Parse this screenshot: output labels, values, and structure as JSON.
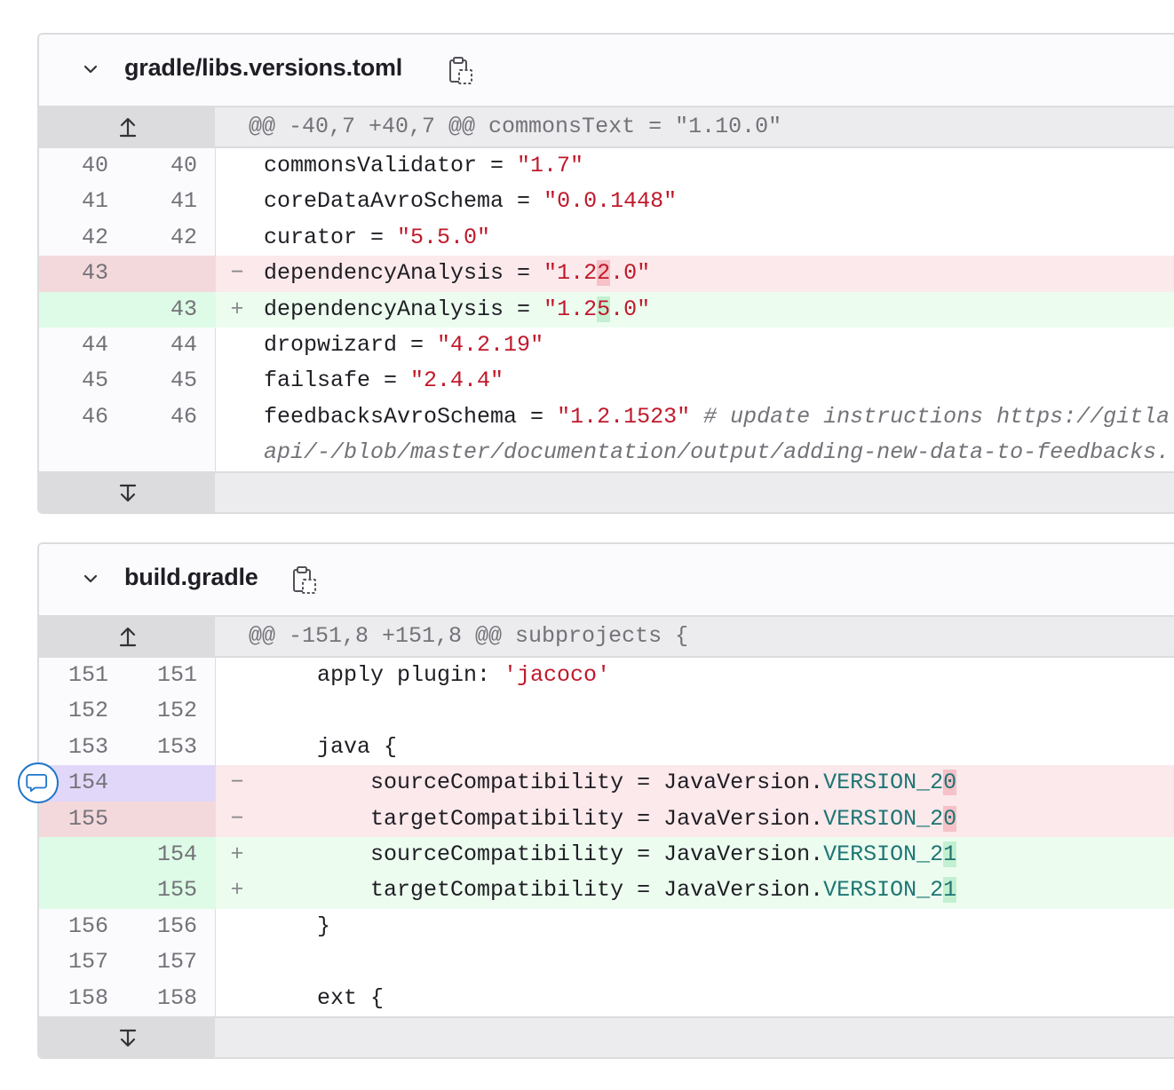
{
  "files": [
    {
      "name": "gradle/libs.versions.toml",
      "hunk_header": "@@ -40,7 +40,7 @@ commonsText = \"1.10.0\"",
      "lines": [
        {
          "type": "ctx",
          "old": "40",
          "new": "40",
          "marker": "",
          "segments": [
            {
              "t": "commonsValidator = "
            },
            {
              "t": "\"1.7\"",
              "c": "s2"
            }
          ]
        },
        {
          "type": "ctx",
          "old": "41",
          "new": "41",
          "marker": "",
          "segments": [
            {
              "t": "coreDataAvroSchema = "
            },
            {
              "t": "\"0.0.1448\"",
              "c": "s2"
            }
          ]
        },
        {
          "type": "ctx",
          "old": "42",
          "new": "42",
          "marker": "",
          "segments": [
            {
              "t": "curator = "
            },
            {
              "t": "\"5.5.0\"",
              "c": "s2"
            }
          ]
        },
        {
          "type": "del",
          "old": "43",
          "new": "",
          "marker": "−",
          "segments": [
            {
              "t": "dependencyAnalysis = "
            },
            {
              "t": "\"1.2",
              "c": "s2"
            },
            {
              "t": "2",
              "c": "s2 hl-del"
            },
            {
              "t": ".0\"",
              "c": "s2"
            }
          ]
        },
        {
          "type": "add",
          "old": "",
          "new": "43",
          "marker": "+",
          "segments": [
            {
              "t": "dependencyAnalysis = "
            },
            {
              "t": "\"1.2",
              "c": "s2"
            },
            {
              "t": "5",
              "c": "s2 hl-add"
            },
            {
              "t": ".0\"",
              "c": "s2"
            }
          ]
        },
        {
          "type": "ctx",
          "old": "44",
          "new": "44",
          "marker": "",
          "segments": [
            {
              "t": "dropwizard = "
            },
            {
              "t": "\"4.2.19\"",
              "c": "s2"
            }
          ]
        },
        {
          "type": "ctx",
          "old": "45",
          "new": "45",
          "marker": "",
          "segments": [
            {
              "t": "failsafe = "
            },
            {
              "t": "\"2.4.4\"",
              "c": "s2"
            }
          ]
        },
        {
          "type": "ctx",
          "old": "46",
          "new": "46",
          "marker": "",
          "segments": [
            {
              "t": "feedbacksAvroSchema = "
            },
            {
              "t": "\"1.2.1523\"",
              "c": "s2"
            },
            {
              "t": " # update instructions https://gitla",
              "c": "cm"
            }
          ]
        },
        {
          "type": "wrap",
          "old": "",
          "new": "",
          "marker": "",
          "segments": [
            {
              "t": "api/-/blob/master/documentation/output/adding-new-data-to-feedbacks.",
              "c": "cm"
            }
          ]
        }
      ]
    },
    {
      "name": "build.gradle",
      "hunk_header": "@@ -151,8 +151,8 @@ subprojects {",
      "lines": [
        {
          "type": "ctx",
          "old": "151",
          "new": "151",
          "marker": "",
          "segments": [
            {
              "t": "    apply plugin: "
            },
            {
              "t": "'jacoco'",
              "c": "s2"
            }
          ]
        },
        {
          "type": "ctx",
          "old": "152",
          "new": "152",
          "marker": "",
          "segments": [
            {
              "t": ""
            }
          ]
        },
        {
          "type": "ctx",
          "old": "153",
          "new": "153",
          "marker": "",
          "segments": [
            {
              "t": "    java "
            },
            {
              "t": "{",
              "c": "kw"
            }
          ]
        },
        {
          "type": "del sel",
          "old": "154",
          "new": "",
          "marker": "−",
          "segments": [
            {
              "t": "        sourceCompatibility = JavaVersion."
            },
            {
              "t": "VERSION_2",
              "c": "cst"
            },
            {
              "t": "0",
              "c": "cst hl-del"
            }
          ]
        },
        {
          "type": "del",
          "old": "155",
          "new": "",
          "marker": "−",
          "segments": [
            {
              "t": "        targetCompatibility = JavaVersion."
            },
            {
              "t": "VERSION_2",
              "c": "cst"
            },
            {
              "t": "0",
              "c": "cst hl-del"
            }
          ]
        },
        {
          "type": "add",
          "old": "",
          "new": "154",
          "marker": "+",
          "segments": [
            {
              "t": "        sourceCompatibility = JavaVersion."
            },
            {
              "t": "VERSION_2",
              "c": "cst"
            },
            {
              "t": "1",
              "c": "cst hl-add"
            }
          ]
        },
        {
          "type": "add",
          "old": "",
          "new": "155",
          "marker": "+",
          "segments": [
            {
              "t": "        targetCompatibility = JavaVersion."
            },
            {
              "t": "VERSION_2",
              "c": "cst"
            },
            {
              "t": "1",
              "c": "cst hl-add"
            }
          ]
        },
        {
          "type": "ctx",
          "old": "156",
          "new": "156",
          "marker": "",
          "segments": [
            {
              "t": "    "
            },
            {
              "t": "}",
              "c": "kw"
            }
          ]
        },
        {
          "type": "ctx",
          "old": "157",
          "new": "157",
          "marker": "",
          "segments": [
            {
              "t": ""
            }
          ]
        },
        {
          "type": "ctx",
          "old": "158",
          "new": "158",
          "marker": "",
          "segments": [
            {
              "t": "    ext "
            },
            {
              "t": "{",
              "c": "kw"
            }
          ]
        }
      ]
    }
  ],
  "icons": {
    "collapse": "chevron-down-icon",
    "copy": "copy-to-clipboard-icon",
    "expand_up": "expand-up-icon",
    "expand_down": "expand-down-icon",
    "comment": "comment-bubble-icon"
  },
  "colors": {
    "deleted_line": "#fbe9eb",
    "added_line": "#ecfdf0",
    "link": "#1f75cb"
  }
}
